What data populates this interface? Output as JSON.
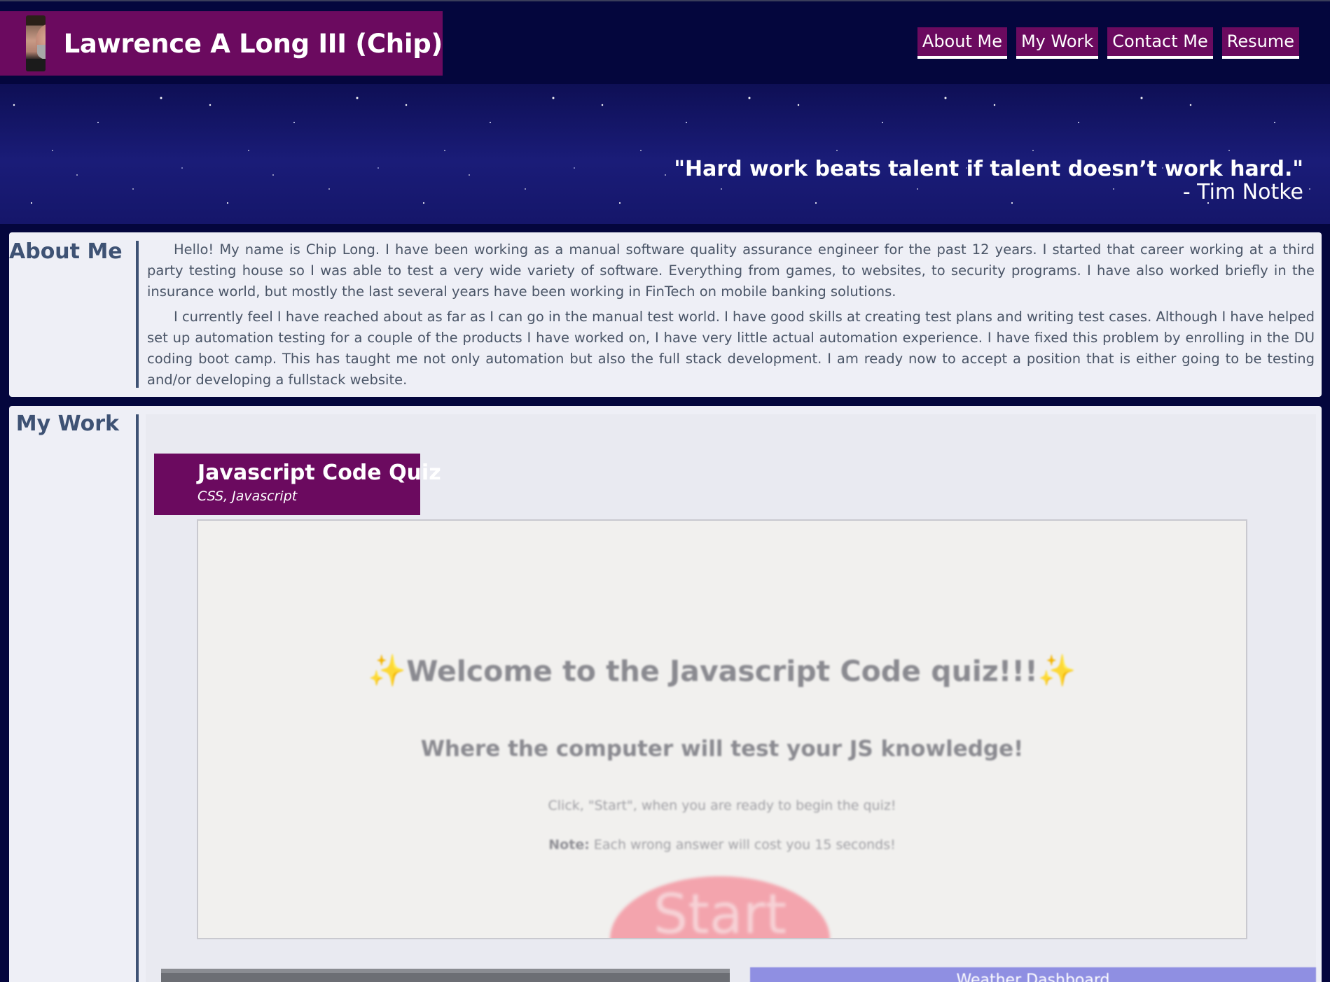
{
  "header": {
    "brand_name": "Lawrence A Long III (Chip)",
    "avatar_alt": "profile photo",
    "nav": [
      "About Me",
      "My Work",
      "Contact Me",
      "Resume"
    ]
  },
  "hero": {
    "quote": "\"Hard work beats talent if talent doesn’t work hard.\"",
    "author": "- Tim Notke"
  },
  "about": {
    "title": "About Me",
    "paragraphs": [
      "Hello! My name is Chip Long. I have been working as a manual software quality assurance engineer for the past 12 years. I started that career working at a third party testing house so I was able to test a very wide variety of software. Everything from games, to websites, to security programs. I have also worked briefly in the insurance world, but mostly the last several years have been working in FinTech on mobile banking solutions.",
      "I currently feel I have reached about as far as I can go in the manual test world. I have good skills at creating test plans and writing test cases. Although I have helped set up automation testing for a couple of the products I have worked on, I have very little actual automation experience. I have fixed this problem by enrolling in the DU coding boot camp. This has taught me not only automation but also the full stack development. I am ready now to accept a position that is either going to be testing and/or developing a fullstack website."
    ]
  },
  "work": {
    "title": "My Work",
    "projects": [
      {
        "name": "Javascript Code Quiz",
        "tech": "CSS, Javascript",
        "preview": {
          "title": "Welcome to the Javascript Code quiz!!!",
          "subtitle": "Where the computer will test your JS knowledge!",
          "instructions": "Click, \"Start\", when you are ready to begin the quiz!",
          "note_label": "Note:",
          "note_text": "Each wrong answer will cost you 15 seconds!",
          "start_label": "Start"
        }
      }
    ],
    "next_preview_label": "Weather Dashboard"
  },
  "colors": {
    "background": "#04063d",
    "accent_purple": "#6b0a5f",
    "section_bg": "#eeeff6",
    "heading": "#3e5274"
  }
}
